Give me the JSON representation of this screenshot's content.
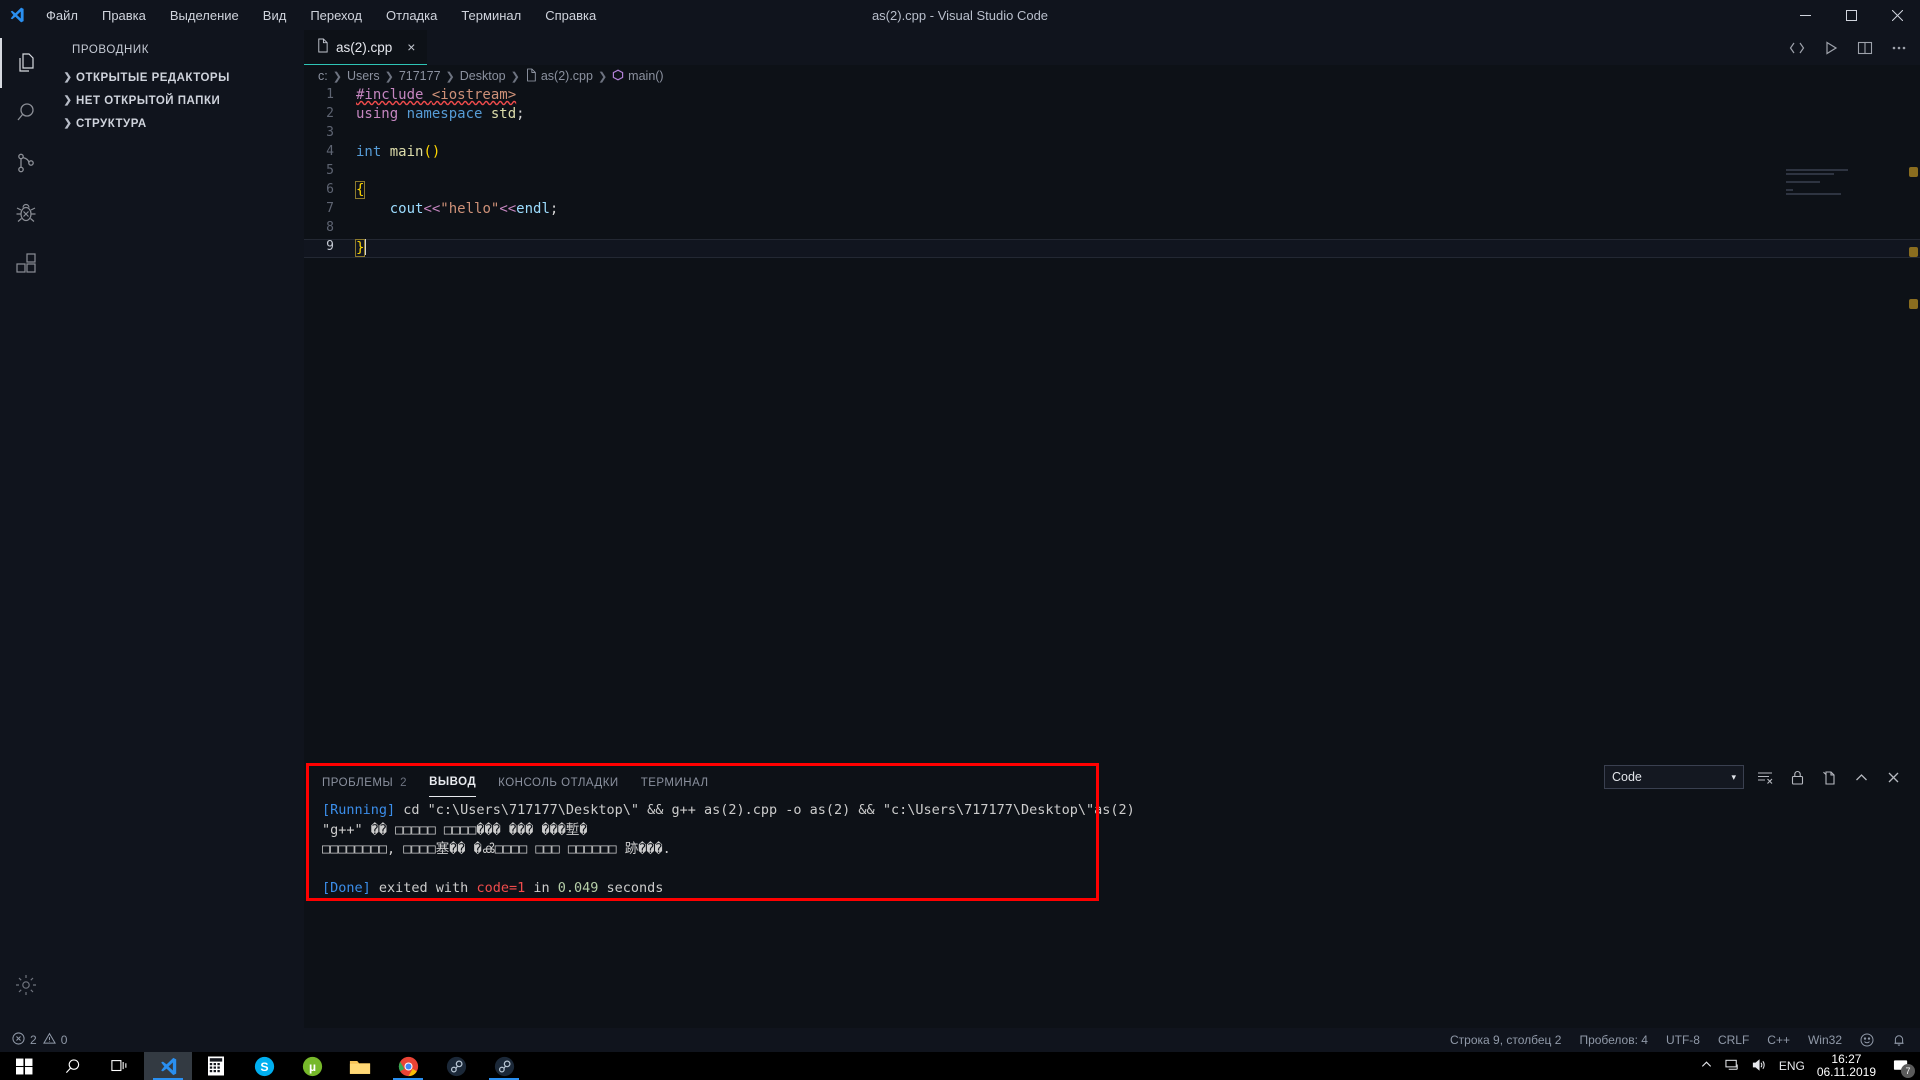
{
  "window": {
    "title": "as(2).cpp - Visual Studio Code",
    "controls": {
      "minimize": "minimize-icon",
      "maximize": "maximize-icon",
      "close": "close-icon"
    }
  },
  "menu": {
    "items": [
      {
        "label": "Файл"
      },
      {
        "label": "Правка"
      },
      {
        "label": "Выделение"
      },
      {
        "label": "Вид"
      },
      {
        "label": "Переход"
      },
      {
        "label": "Отладка"
      },
      {
        "label": "Терминал"
      },
      {
        "label": "Справка"
      }
    ]
  },
  "activity_bar": {
    "items": [
      {
        "name": "explorer-icon",
        "label": "Проводник",
        "active": true
      },
      {
        "name": "search-icon",
        "label": "Поиск",
        "active": false
      },
      {
        "name": "source-control-icon",
        "label": "Система управления версиями",
        "active": false
      },
      {
        "name": "debug-icon",
        "label": "Отладка",
        "active": false
      },
      {
        "name": "extensions-icon",
        "label": "Расширения",
        "active": false
      }
    ],
    "bottom": {
      "name": "gear-icon",
      "label": "Управление"
    }
  },
  "sidebar": {
    "title": "ПРОВОДНИК",
    "sections": [
      {
        "label": "ОТКРЫТЫЕ РЕДАКТОРЫ",
        "expanded": false
      },
      {
        "label": "НЕТ ОТКРЫТОЙ ПАПКИ",
        "expanded": false
      },
      {
        "label": "СТРУКТУРА",
        "expanded": false
      }
    ]
  },
  "editor": {
    "tab": {
      "label": "as(2).cpp",
      "icon": "file-icon",
      "close": "×",
      "active": true
    },
    "actions": [
      {
        "name": "run-code-icon",
        "label": "Run Code"
      },
      {
        "name": "run-play-icon",
        "label": "Запустить"
      },
      {
        "name": "split-editor-icon",
        "label": "Разделить редактор"
      },
      {
        "name": "more-actions-icon",
        "label": "Дополнительные действия"
      }
    ],
    "breadcrumb": [
      "c:",
      "Users",
      "717177",
      "Desktop",
      "as(2).cpp",
      "main()"
    ],
    "lines": [
      {
        "n": "1",
        "tokens": [
          {
            "t": "#include ",
            "c": "k-purple",
            "squiggle": true
          },
          {
            "t": "<iostream>",
            "c": "k-orange",
            "squiggle": true
          }
        ]
      },
      {
        "n": "2",
        "tokens": [
          {
            "t": "using ",
            "c": "k-purple"
          },
          {
            "t": "namespace ",
            "c": "k-blue"
          },
          {
            "t": "std",
            "c": "k-yellow"
          },
          {
            "t": ";",
            "c": "k-white"
          }
        ]
      },
      {
        "n": "3",
        "tokens": [
          {
            "t": "",
            "c": "k-white"
          }
        ]
      },
      {
        "n": "4",
        "tokens": [
          {
            "t": "int ",
            "c": "k-blue"
          },
          {
            "t": "main",
            "c": "k-yellow"
          },
          {
            "t": "()",
            "c": "k-gold"
          }
        ]
      },
      {
        "n": "5",
        "tokens": [
          {
            "t": "",
            "c": "k-white"
          }
        ]
      },
      {
        "n": "6",
        "tokens": [
          {
            "t": "{",
            "c": "k-gold",
            "box": true
          }
        ]
      },
      {
        "n": "7",
        "tokens": [
          {
            "t": "    cout",
            "c": "k-lblue"
          },
          {
            "t": "<<",
            "c": "k-purple"
          },
          {
            "t": "\"hello\"",
            "c": "k-orange"
          },
          {
            "t": "<<",
            "c": "k-purple"
          },
          {
            "t": "endl",
            "c": "k-lblue"
          },
          {
            "t": ";",
            "c": "k-white"
          }
        ]
      },
      {
        "n": "8",
        "tokens": [
          {
            "t": "",
            "c": "k-white"
          }
        ]
      },
      {
        "n": "9",
        "tokens": [
          {
            "t": "}",
            "c": "k-gold",
            "box": true
          }
        ],
        "current": true,
        "cursor": true
      }
    ]
  },
  "panel": {
    "tabs": [
      {
        "label": "ПРОБЛЕМЫ",
        "badge": "2",
        "active": false
      },
      {
        "label": "ВЫВОД",
        "badge": "",
        "active": true
      },
      {
        "label": "КОНСОЛЬ ОТЛАДКИ",
        "badge": "",
        "active": false
      },
      {
        "label": "ТЕРМИНАЛ",
        "badge": "",
        "active": false
      }
    ],
    "channel_select": {
      "value": "Code",
      "chevron": "▾"
    },
    "actions": [
      {
        "name": "clear-output-icon",
        "label": "Очистить вывод"
      },
      {
        "name": "lock-scroll-icon",
        "label": "Закрепить прокрутку"
      },
      {
        "name": "open-in-editor-icon",
        "label": "Открыть в редакторе"
      },
      {
        "name": "maximize-panel-icon",
        "label": "Развернуть панель"
      },
      {
        "name": "close-panel-icon",
        "label": "Закрыть панель"
      }
    ],
    "output": {
      "running_tag": "[Running]",
      "running_cmd": " cd \"c:\\Users\\717177\\Desktop\\\" && g++ as(2).cpp -o as(2) && \"c:\\Users\\717177\\Desktop\\\"as(2)",
      "err_line_1": "\"g++\" �� □□□□□ □□□□୹��� ��� ���塹�",
      "err_line_2": "□□□□□□□□, □□□□塞�� �ൿ□□□□ □□□ □□□□□□ 跡���.",
      "done_tag": "[Done]",
      "done_mid": " exited with ",
      "done_code": "code=1",
      "done_in": " in ",
      "done_time": "0.049",
      "done_unit": " seconds"
    },
    "highlight_color": "#ff0000"
  },
  "statusbar": {
    "left": [
      {
        "name": "error-icon",
        "glyph": "ⓧ",
        "value": "2"
      },
      {
        "name": "warning-icon",
        "glyph": "⚠",
        "value": "0"
      }
    ],
    "right": [
      {
        "name": "cursor-position",
        "label": "Строка 9, столбец 2"
      },
      {
        "name": "indentation",
        "label": "Пробелов: 4"
      },
      {
        "name": "encoding",
        "label": "UTF-8"
      },
      {
        "name": "eol",
        "label": "CRLF"
      },
      {
        "name": "language-mode",
        "label": "C++"
      },
      {
        "name": "platform",
        "label": "Win32"
      },
      {
        "name": "feedback-smiley-icon",
        "label": "☺"
      },
      {
        "name": "notifications-bell-icon",
        "label": "🔔"
      }
    ]
  },
  "taskbar": {
    "items": [
      {
        "name": "start-button",
        "label": "Пуск"
      },
      {
        "name": "search-taskbar-icon",
        "label": "Поиск"
      },
      {
        "name": "task-view-icon",
        "label": "Представление задач"
      },
      {
        "name": "vscode-taskbar-icon",
        "label": "Visual Studio Code",
        "active": true
      },
      {
        "name": "calculator-taskbar-icon",
        "label": "Калькулятор"
      },
      {
        "name": "skype-taskbar-icon",
        "label": "Skype"
      },
      {
        "name": "utorrent-taskbar-icon",
        "label": "uTorrent"
      },
      {
        "name": "explorer-taskbar-icon",
        "label": "Проводник"
      },
      {
        "name": "chrome-taskbar-icon",
        "label": "Google Chrome",
        "running": true
      },
      {
        "name": "steam-taskbar-icon",
        "label": "Steam"
      },
      {
        "name": "steam2-taskbar-icon",
        "label": "Steam",
        "running": true
      }
    ],
    "tray": {
      "show_hidden": "chevron-up-icon",
      "network": "network-icon",
      "volume": "volume-icon",
      "language": "ENG",
      "time": "16:27",
      "date": "06.11.2019",
      "notification_count": "7"
    }
  },
  "colors": {
    "accent": "#2ec4b6",
    "editor_bg": "#0d1117",
    "chrome_bg": "#10141d",
    "error": "#f14c4c",
    "highlight": "#ff0000"
  }
}
